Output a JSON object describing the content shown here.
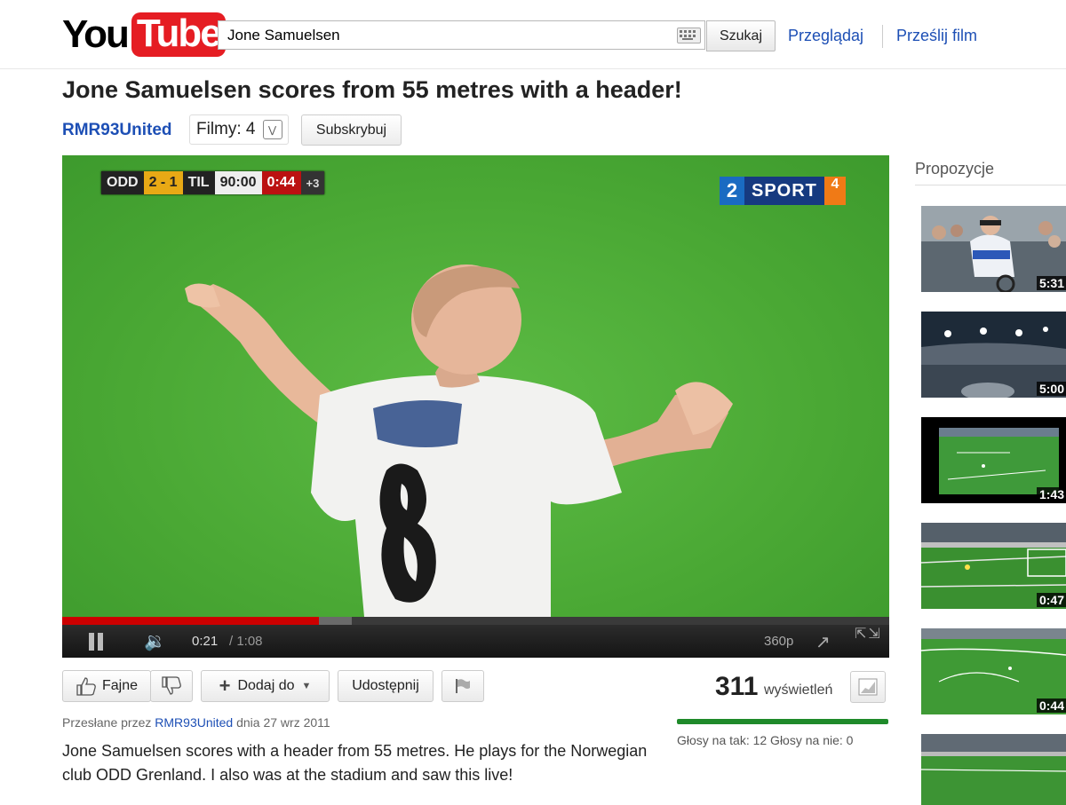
{
  "header": {
    "logo_you": "You",
    "logo_tube": "Tube",
    "search_value": "Jone Samuelsen",
    "search_button": "Szukaj",
    "nav_browse": "Przeglądaj",
    "nav_upload": "Prześlij film"
  },
  "video": {
    "title": "Jone Samuelsen scores from 55 metres with a header!",
    "channel": "RMR93United",
    "films_label": "Filmy: 4",
    "subscribe_label": "Subskrybuj",
    "scorebug": {
      "team1": "ODD",
      "score": "2 - 1",
      "team2": "TIL",
      "clock": "90:00",
      "extra": "0:44",
      "plus": "+3"
    },
    "broadcaster": {
      "num": "2",
      "name": "SPORT",
      "ch": "4"
    },
    "player": {
      "time_current": "0:21",
      "time_total": "/ 1:08",
      "quality": "360p",
      "progress_fraction": 0.31,
      "buffered_fraction": 0.35
    }
  },
  "actions": {
    "like_label": "Fajne",
    "add_label": "Dodaj do",
    "share_label": "Udostępnij",
    "views_count": "311",
    "views_label": "wyświetleń",
    "votes_text": "Głosy na tak: 12 Głosy na nie: 0",
    "like_fraction": 1.0
  },
  "meta": {
    "uploaded_prefix": "Przesłane przez",
    "uploaded_channel": "RMR93United",
    "uploaded_date": "dnia 27 wrz 2011",
    "description": "Jone Samuelsen scores with a header from 55 metres. He plays for the Norwegian club ODD Grenland. I also was at the stadium and saw this live!"
  },
  "sidebar": {
    "title": "Propozycje",
    "items": [
      {
        "duration": "5:31"
      },
      {
        "duration": "5:00"
      },
      {
        "duration": "1:43"
      },
      {
        "duration": "0:47"
      },
      {
        "duration": "0:44"
      },
      {
        "duration": ""
      }
    ]
  },
  "colors": {
    "link_blue": "#1d4fb5",
    "brand_red": "#e51d23",
    "progress_red": "#cc0000",
    "like_green": "#1f8a2a"
  }
}
